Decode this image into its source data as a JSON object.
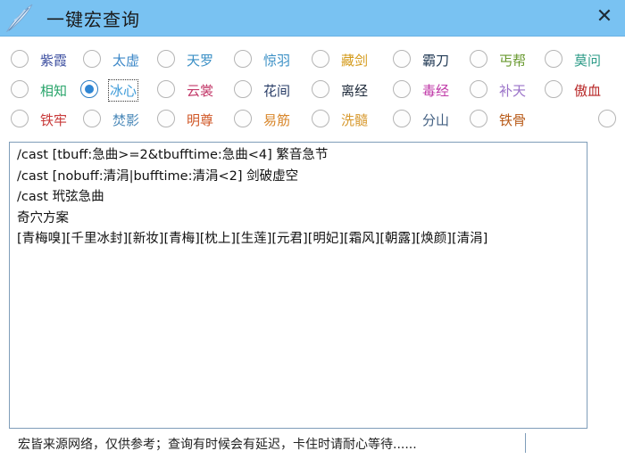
{
  "window": {
    "title": "一键宏查询",
    "close_symbol": "✕",
    "icon": "sword-feather-icon"
  },
  "schools": [
    {
      "label": "紫霞",
      "color": "#3d4fa0"
    },
    {
      "label": "太虚",
      "color": "#3d88c8"
    },
    {
      "label": "天罗",
      "color": "#3a8fc5"
    },
    {
      "label": "惊羽",
      "color": "#3a8fc5"
    },
    {
      "label": "藏剑",
      "color": "#d49a1a"
    },
    {
      "label": "霸刀",
      "color": "#223a55"
    },
    {
      "label": "丐帮",
      "color": "#6a9a30"
    },
    {
      "label": "莫问",
      "color": "#2a9a86"
    },
    {
      "label": "相知",
      "color": "#28a46a"
    },
    {
      "label": "冰心",
      "color": "#3c9ad8"
    },
    {
      "label": "云裳",
      "color": "#c33a6a"
    },
    {
      "label": "花间",
      "color": "#2a3e68"
    },
    {
      "label": "离经",
      "color": "#1e2a3a"
    },
    {
      "label": "毒经",
      "color": "#c03aa8"
    },
    {
      "label": "补天",
      "color": "#9a72c8"
    },
    {
      "label": "傲血",
      "color": "#b82828"
    },
    {
      "label": "铁牢",
      "color": "#c83a3a"
    },
    {
      "label": "焚影",
      "color": "#4a88b8"
    },
    {
      "label": "明尊",
      "color": "#d05828"
    },
    {
      "label": "易筋",
      "color": "#d8862a"
    },
    {
      "label": "洗髓",
      "color": "#d89a30"
    },
    {
      "label": "分山",
      "color": "#405e80"
    },
    {
      "label": "铁骨",
      "color": "#b85a18"
    },
    {
      "label": "",
      "color": "#888888"
    }
  ],
  "selected_school": "冰心",
  "macro": {
    "lines": [
      "/cast [tbuff:急曲>=2&tbufftime:急曲<4] 繁音急节",
      "/cast [nobuff:清涓|bufftime:清涓<2] 剑破虚空",
      "/cast 玳弦急曲",
      "奇穴方案",
      "[青梅嗅][千里冰封][新妆][青梅][枕上][生莲][元君][明妃][霜风][朝露][焕颜][清涓]"
    ]
  },
  "footer": {
    "notice": "宏皆来源网络，仅供参考；查询有时候会有延迟，卡住时请耐心等待......"
  }
}
